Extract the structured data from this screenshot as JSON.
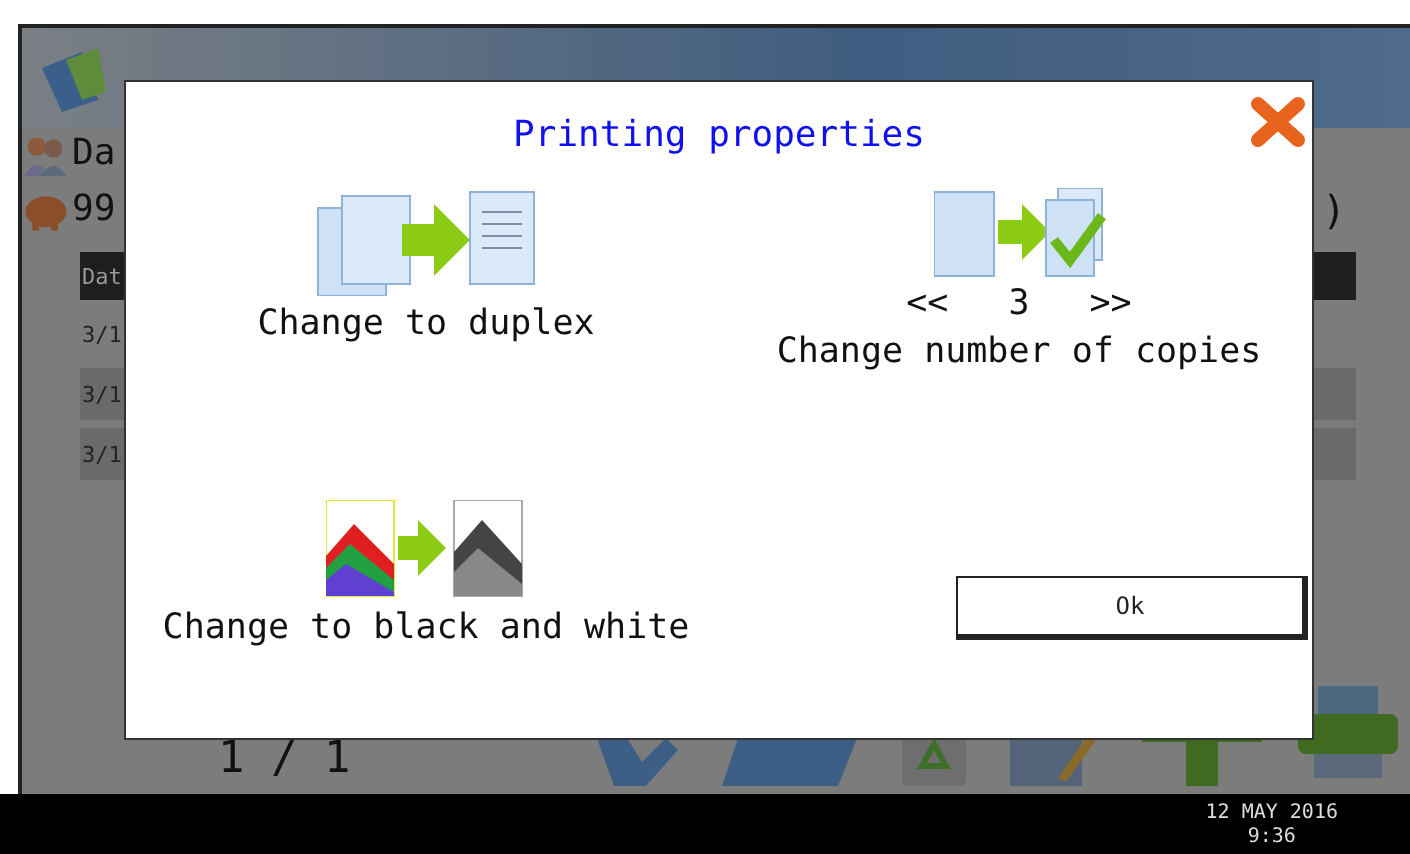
{
  "app": {
    "user": "Da",
    "balance": "99",
    "balance_suffix": ")",
    "table": {
      "header": "Dat",
      "rows": [
        {
          "text": "3/1",
          "selected": false
        },
        {
          "text": "3/1",
          "selected": true
        },
        {
          "text": "3/1",
          "selected": true
        }
      ]
    },
    "page_indicator": "1 / 1"
  },
  "dialog": {
    "title": "Printing properties",
    "options": [
      {
        "kind": "duplex",
        "label": "Change to duplex"
      },
      {
        "kind": "copies",
        "label": "Change number of copies",
        "decrement": "<<",
        "count": "3",
        "increment": ">>"
      },
      {
        "kind": "bw",
        "label": "Change to black and white"
      }
    ],
    "ok_button": "Ok"
  },
  "status_bar": {
    "date": "12 MAY  2016",
    "time": "9:36"
  }
}
